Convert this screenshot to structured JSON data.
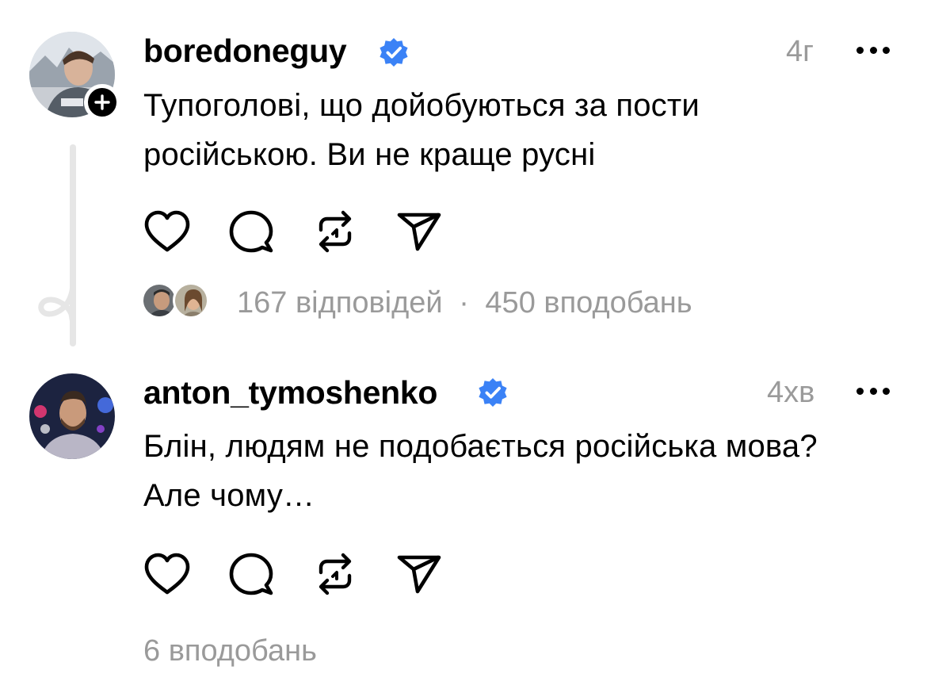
{
  "posts": [
    {
      "username": "boredoneguy",
      "time": "4г",
      "text": "Тупоголові, що дойобуються за пости російською. Ви не краще русні",
      "replies": "167 відповідей",
      "separator": "·",
      "likes": "450 вподобань",
      "verified": true,
      "follow_badge": "plus-icon"
    },
    {
      "username": "anton_tymoshenko",
      "time": "4хв",
      "text": "Блін, людям не подобається російська мова? Але чому…",
      "likes": "6 вподобань",
      "verified": true
    }
  ],
  "icons": {
    "like": "heart-icon",
    "reply": "comment-bubble-icon",
    "repost": "repost-icon",
    "share": "send-icon",
    "more": "more-dots-icon",
    "verified": "verified-badge-icon"
  },
  "colors": {
    "verified": "#3b82f6",
    "muted": "#9a9a9a",
    "text": "#000000"
  }
}
